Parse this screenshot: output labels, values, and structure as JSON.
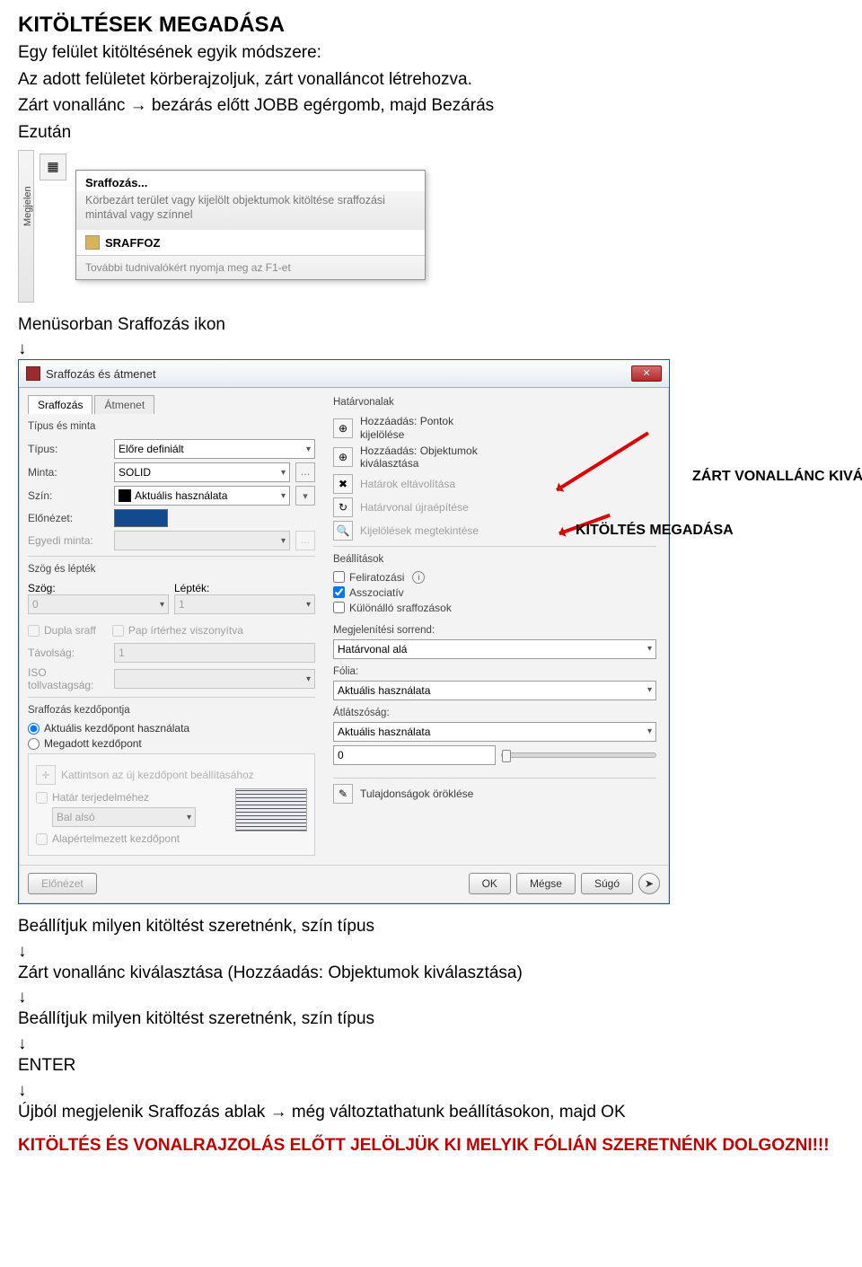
{
  "doc": {
    "title": "KITÖLTÉSEK MEGADÁSA",
    "line1": "Egy felület kitöltésének egyik módszere:",
    "line2": "Az adott felületet körberajzoljuk, zárt vonalláncot létrehozva.",
    "line3": "Zárt vonallánc → bezárás előtt JOBB egérgomb, majd Bezárás",
    "line4": "Ezután",
    "line5": "Menüsorban Sraffozás ikon",
    "down": "↓",
    "p6": "Beállítjuk milyen kitöltést szeretnénk, szín típus",
    "p7": "Zárt vonallánc kiválasztása (Hozzáadás: Objektumok kiválasztása)",
    "p8": "Beállítjuk milyen kitöltést szeretnénk, szín típus",
    "p9": "ENTER",
    "p10": "Újból megjelenik Sraffozás ablak → még változtathatunk beállításokon, majd OK",
    "footer": "KITÖLTÉS ÉS VONALRAJZOLÁS ELŐTT JELÖLJÜK KI MELYIK FÓLIÁN SZERETNÉNK DOLGOZNI!!!"
  },
  "tooltip": {
    "sidebar": "Megjelen",
    "title": "Sraffozás...",
    "desc": "Körbezárt terület vagy kijelölt objektumok kitöltése sraffozási mintával vagy színnel",
    "cmd": "SRAFFOZ",
    "f1": "További tudnivalókért nyomja meg az F1-et"
  },
  "dlg": {
    "title": "Sraffozás és átmenet",
    "tabs": {
      "t1": "Sraffozás",
      "t2": "Átmenet"
    },
    "left": {
      "group1": "Típus és minta",
      "type_label": "Típus:",
      "type_value": "Előre definiált",
      "pattern_label": "Minta:",
      "pattern_value": "SOLID",
      "color_label": "Szín:",
      "color_value": "Aktuális használata",
      "preview_label": "Előnézet:",
      "custom_label": "Egyedi minta:",
      "group2": "Szög és lépték",
      "angle_label": "Szög:",
      "angle_value": "0",
      "scale_label": "Lépték:",
      "scale_value": "1",
      "chk_dupla": "Dupla sraff",
      "chk_pap": "Pap írtérhez viszonyítva",
      "spacing_label": "Távolság:",
      "spacing_value": "1",
      "iso_label": "ISO tollvastagság:",
      "group3": "Sraffozás kezdőpontja",
      "rad1": "Aktuális kezdőpont használata",
      "rad2": "Megadott kezdőpont",
      "inner_btn": "Kattintson az új kezdőpont beállításához",
      "inner_chk": "Határ terjedelméhez",
      "inner_combo": "Bal alsó",
      "inner_chk2": "Alapértelmezett kezdőpont"
    },
    "right": {
      "group1": "Határvonalak",
      "pick1a": "Hozzáadás: Pontok",
      "pick1b": "kijelölése",
      "pick2a": "Hozzáadás: Objektumok",
      "pick2b": "kiválasztása",
      "pick3": "Határok eltávolítása",
      "pick4": "Határvonal újraépítése",
      "pick5": "Kijelölések megtekintése",
      "group2": "Beállítások",
      "chk1": "Feliratozási",
      "chk2": "Asszociatív",
      "chk3": "Különálló sraffozások",
      "order_label": "Megjelenítési sorrend:",
      "order_value": "Határvonal alá",
      "layer_label": "Fólia:",
      "layer_value": "Aktuális használata",
      "trans_label": "Átlátszóság:",
      "trans_value": "Aktuális használata",
      "trans_num": "0",
      "chk_inherit": "Tulajdonságok öröklése"
    },
    "buttons": {
      "preview": "Előnézet",
      "ok": "OK",
      "cancel": "Mégse",
      "help": "Súgó"
    },
    "ann1": "ZÁRT VONALLÁNC KIVÁLASZTÁSA",
    "ann2": "KITÖLTÉS MEGADÁSA"
  }
}
